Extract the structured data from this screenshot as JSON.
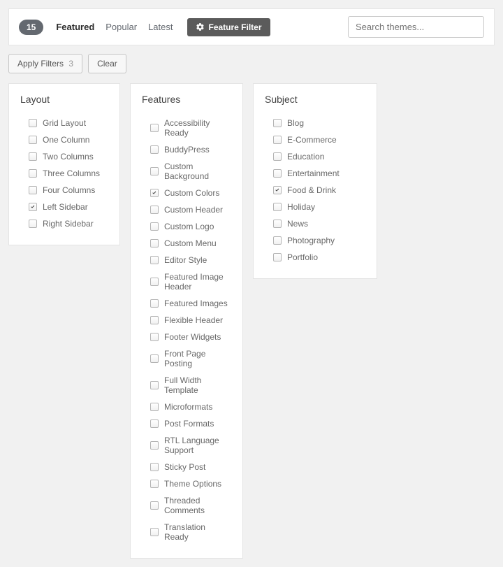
{
  "topbar": {
    "count": "15",
    "tabs": [
      {
        "label": "Featured",
        "active": true
      },
      {
        "label": "Popular",
        "active": false
      },
      {
        "label": "Latest",
        "active": false
      }
    ],
    "feature_filter_label": "Feature Filter",
    "search": {
      "placeholder": "Search themes..."
    }
  },
  "actions": {
    "apply_label": "Apply Filters",
    "apply_count": "3",
    "clear_label": "Clear"
  },
  "columns": {
    "layout": {
      "heading": "Layout",
      "items": [
        {
          "label": "Grid Layout",
          "checked": false
        },
        {
          "label": "One Column",
          "checked": false
        },
        {
          "label": "Two Columns",
          "checked": false
        },
        {
          "label": "Three Columns",
          "checked": false
        },
        {
          "label": "Four Columns",
          "checked": false
        },
        {
          "label": "Left Sidebar",
          "checked": true
        },
        {
          "label": "Right Sidebar",
          "checked": false
        }
      ]
    },
    "features": {
      "heading": "Features",
      "items": [
        {
          "label": "Accessibility Ready",
          "checked": false
        },
        {
          "label": "BuddyPress",
          "checked": false
        },
        {
          "label": "Custom Background",
          "checked": false
        },
        {
          "label": "Custom Colors",
          "checked": true
        },
        {
          "label": "Custom Header",
          "checked": false
        },
        {
          "label": "Custom Logo",
          "checked": false
        },
        {
          "label": "Custom Menu",
          "checked": false
        },
        {
          "label": "Editor Style",
          "checked": false
        },
        {
          "label": "Featured Image Header",
          "checked": false
        },
        {
          "label": "Featured Images",
          "checked": false
        },
        {
          "label": "Flexible Header",
          "checked": false
        },
        {
          "label": "Footer Widgets",
          "checked": false
        },
        {
          "label": "Front Page Posting",
          "checked": false
        },
        {
          "label": "Full Width Template",
          "checked": false
        },
        {
          "label": "Microformats",
          "checked": false
        },
        {
          "label": "Post Formats",
          "checked": false
        },
        {
          "label": "RTL Language Support",
          "checked": false
        },
        {
          "label": "Sticky Post",
          "checked": false
        },
        {
          "label": "Theme Options",
          "checked": false
        },
        {
          "label": "Threaded Comments",
          "checked": false
        },
        {
          "label": "Translation Ready",
          "checked": false
        }
      ]
    },
    "subject": {
      "heading": "Subject",
      "items": [
        {
          "label": "Blog",
          "checked": false
        },
        {
          "label": "E-Commerce",
          "checked": false
        },
        {
          "label": "Education",
          "checked": false
        },
        {
          "label": "Entertainment",
          "checked": false
        },
        {
          "label": "Food & Drink",
          "checked": true
        },
        {
          "label": "Holiday",
          "checked": false
        },
        {
          "label": "News",
          "checked": false
        },
        {
          "label": "Photography",
          "checked": false
        },
        {
          "label": "Portfolio",
          "checked": false
        }
      ]
    }
  }
}
